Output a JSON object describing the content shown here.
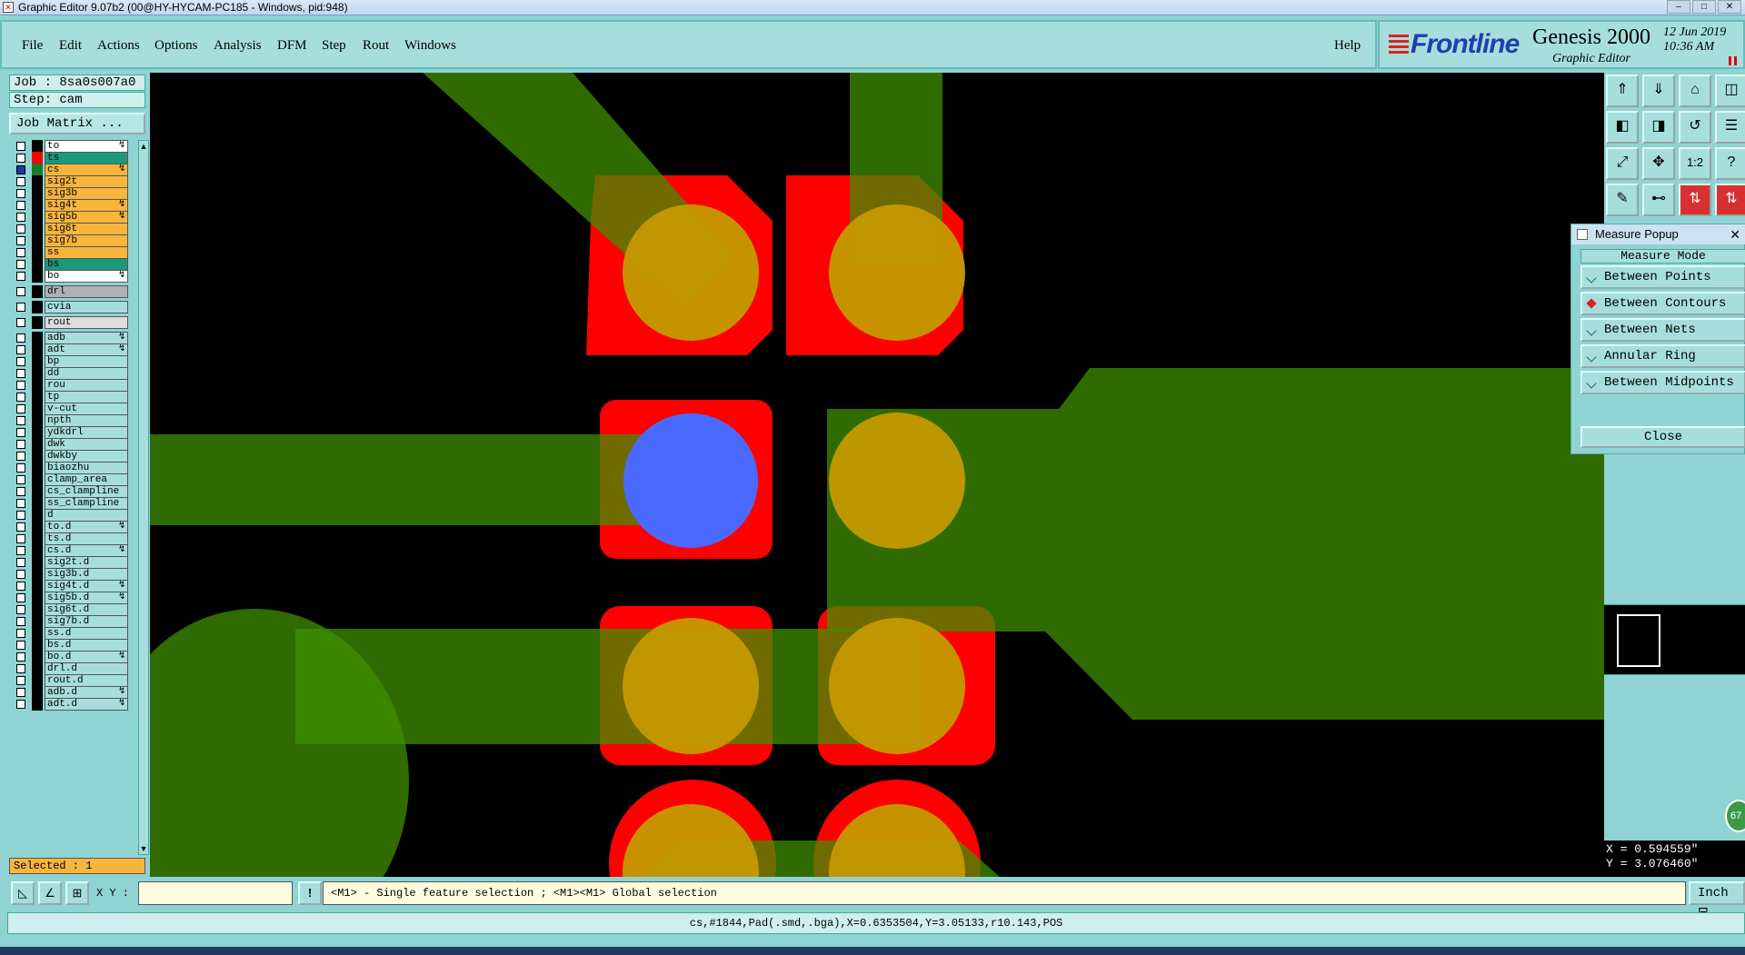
{
  "window": {
    "title": "Graphic Editor 9.07b2 (00@HY-HYCAM-PC185 - Windows, pid:948)"
  },
  "menu": [
    {
      "label": "File"
    },
    {
      "label": "Edit"
    },
    {
      "label": "Actions"
    },
    {
      "label": "Options"
    },
    {
      "label": "Analysis"
    },
    {
      "label": "DFM"
    },
    {
      "label": "Step"
    },
    {
      "label": "Rout"
    },
    {
      "label": "Windows"
    }
  ],
  "help_label": "Help",
  "logo": {
    "brand": "Frontline",
    "product": "Genesis 2000",
    "subtitle": "Graphic Editor",
    "date": "12 Jun 2019",
    "time": "10:36 AM"
  },
  "job": {
    "job_label": "Job : 8sa0s007a0",
    "step_label": "Step: cam",
    "matrix_button": "Job Matrix ..."
  },
  "layers": [
    {
      "name": "to",
      "color": "#ffffff",
      "ind": "#000000",
      "bolt": true
    },
    {
      "name": "ts",
      "color": "#1a9a7a",
      "ind": "#ff0000",
      "bolt": false
    },
    {
      "name": "cs",
      "color": "#f7b53b",
      "ind": "#1a7a2a",
      "bolt": true,
      "selected": true
    },
    {
      "name": "sig2t",
      "color": "#f7b53b",
      "ind": "#000000",
      "bolt": false
    },
    {
      "name": "sig3b",
      "color": "#f7b53b",
      "ind": "#000000",
      "bolt": false
    },
    {
      "name": "sig4t",
      "color": "#f7b53b",
      "ind": "#000000",
      "bolt": true
    },
    {
      "name": "sig5b",
      "color": "#f7b53b",
      "ind": "#000000",
      "bolt": true
    },
    {
      "name": "sig6t",
      "color": "#f7b53b",
      "ind": "#000000",
      "bolt": false
    },
    {
      "name": "sig7b",
      "color": "#f7b53b",
      "ind": "#000000",
      "bolt": false
    },
    {
      "name": "ss",
      "color": "#f7b53b",
      "ind": "#000000",
      "bolt": false
    },
    {
      "name": "bs",
      "color": "#1a9a7a",
      "ind": "#000000",
      "bolt": false
    },
    {
      "name": "bo",
      "color": "#ffffff",
      "ind": "#000000",
      "bolt": true
    },
    {
      "name": "drl",
      "color": "#b0b0b0",
      "ind": "#000000",
      "bolt": false,
      "gap": true
    },
    {
      "name": "cvia",
      "color": "#a6dede",
      "ind": "#000000",
      "bolt": false,
      "gap": true
    },
    {
      "name": "rout",
      "color": "#dddddd",
      "ind": "#000000",
      "bolt": false,
      "gap": true
    },
    {
      "name": "adb",
      "color": "#a6dede",
      "ind": "#000000",
      "bolt": true,
      "gap": true
    },
    {
      "name": "adt",
      "color": "#a6dede",
      "ind": "#000000",
      "bolt": true
    },
    {
      "name": "bp",
      "color": "#a6dede",
      "ind": "#000000",
      "bolt": false
    },
    {
      "name": "dd",
      "color": "#a6dede",
      "ind": "#000000",
      "bolt": false
    },
    {
      "name": "rou",
      "color": "#a6dede",
      "ind": "#000000",
      "bolt": false
    },
    {
      "name": "tp",
      "color": "#a6dede",
      "ind": "#000000",
      "bolt": false
    },
    {
      "name": "v-cut",
      "color": "#a6dede",
      "ind": "#000000",
      "bolt": false
    },
    {
      "name": "npth",
      "color": "#a6dede",
      "ind": "#000000",
      "bolt": false
    },
    {
      "name": "ydkdrl",
      "color": "#a6dede",
      "ind": "#000000",
      "bolt": false
    },
    {
      "name": "dwk",
      "color": "#a6dede",
      "ind": "#000000",
      "bolt": false
    },
    {
      "name": "dwkby",
      "color": "#a6dede",
      "ind": "#000000",
      "bolt": false
    },
    {
      "name": "biaozhu",
      "color": "#a6dede",
      "ind": "#000000",
      "bolt": false
    },
    {
      "name": "clamp_area",
      "color": "#a6dede",
      "ind": "#000000",
      "bolt": false
    },
    {
      "name": "cs_clampline",
      "color": "#a6dede",
      "ind": "#000000",
      "bolt": false
    },
    {
      "name": "ss_clampline",
      "color": "#a6dede",
      "ind": "#000000",
      "bolt": false
    },
    {
      "name": "d",
      "color": "#a6dede",
      "ind": "#000000",
      "bolt": false
    },
    {
      "name": "to.d",
      "color": "#a6dede",
      "ind": "#000000",
      "bolt": true
    },
    {
      "name": "ts.d",
      "color": "#a6dede",
      "ind": "#000000",
      "bolt": false
    },
    {
      "name": "cs.d",
      "color": "#a6dede",
      "ind": "#000000",
      "bolt": true
    },
    {
      "name": "sig2t.d",
      "color": "#a6dede",
      "ind": "#000000",
      "bolt": false
    },
    {
      "name": "sig3b.d",
      "color": "#a6dede",
      "ind": "#000000",
      "bolt": false
    },
    {
      "name": "sig4t.d",
      "color": "#a6dede",
      "ind": "#000000",
      "bolt": true
    },
    {
      "name": "sig5b.d",
      "color": "#a6dede",
      "ind": "#000000",
      "bolt": true
    },
    {
      "name": "sig6t.d",
      "color": "#a6dede",
      "ind": "#000000",
      "bolt": false
    },
    {
      "name": "sig7b.d",
      "color": "#a6dede",
      "ind": "#000000",
      "bolt": false
    },
    {
      "name": "ss.d",
      "color": "#a6dede",
      "ind": "#000000",
      "bolt": false
    },
    {
      "name": "bs.d",
      "color": "#a6dede",
      "ind": "#000000",
      "bolt": false
    },
    {
      "name": "bo.d",
      "color": "#a6dede",
      "ind": "#000000",
      "bolt": true
    },
    {
      "name": "drl.d",
      "color": "#a6dede",
      "ind": "#000000",
      "bolt": false
    },
    {
      "name": "rout.d",
      "color": "#a6dede",
      "ind": "#000000",
      "bolt": false
    },
    {
      "name": "adb.d",
      "color": "#a6dede",
      "ind": "#000000",
      "bolt": true
    },
    {
      "name": "adt.d",
      "color": "#a6dede",
      "ind": "#000000",
      "bolt": true
    }
  ],
  "selected_count": "Selected : 1",
  "measure": {
    "title": "Measure Popup",
    "mode_label": "Measure Mode",
    "options": [
      {
        "label": "Between Points",
        "active": false
      },
      {
        "label": "Between Contours",
        "active": true
      },
      {
        "label": "Between Nets",
        "active": false
      },
      {
        "label": "Annular Ring",
        "active": false
      },
      {
        "label": "Between Midpoints",
        "active": false
      }
    ],
    "close_label": "Close"
  },
  "coords": {
    "x": "X = 0.594559\"",
    "y": "Y = 3.076460\""
  },
  "bubble": "67",
  "bottom": {
    "xy_label": "X Y :",
    "xy_value": "",
    "prompt": "<M1> - Single feature selection ; <M1><M1> Global selection",
    "unit": "Inch"
  },
  "status": "cs,#1844,Pad(.smd,.bga),X=0.6353504,Y=3.05133,r10.143,POS",
  "colors": {
    "trace": "#3f8f00",
    "pad": "#c49a00",
    "mask": "#ff0000",
    "drill": "#4a6aff",
    "canvas": "#000000"
  },
  "toolbar_icons": [
    "layer-up-icon",
    "layer-down-icon",
    "home-icon",
    "split-icon",
    "pan-left-icon",
    "pan-right-icon",
    "undo-icon",
    "menu-icon",
    "zoom-fit-icon",
    "zoom-center-icon",
    "one-to-one-icon",
    "help-icon",
    "snap-icon",
    "measure-icon",
    "filter-icon",
    "filter2-icon"
  ]
}
